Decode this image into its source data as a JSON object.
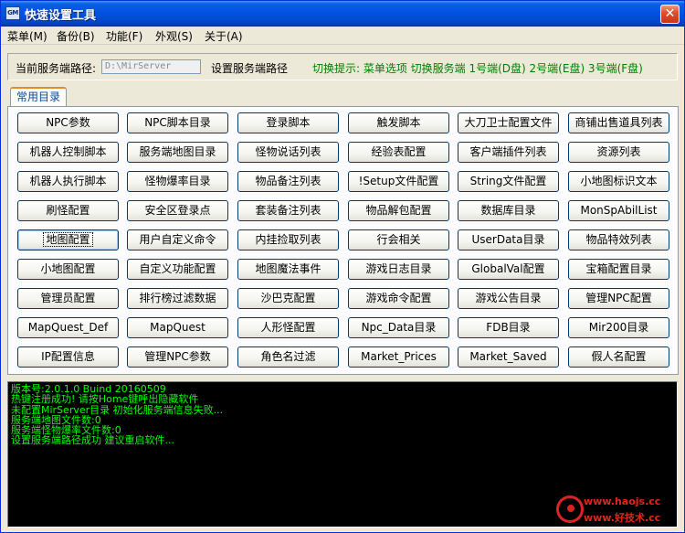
{
  "window": {
    "title": "快速设置工具",
    "icon_text": "GM",
    "close_label": "✕"
  },
  "menu": [
    {
      "label": "菜单(M)"
    },
    {
      "label": "备份(B)"
    },
    {
      "label": "功能(F)"
    },
    {
      "label": "外观(S)"
    },
    {
      "label": "关于(A)"
    }
  ],
  "path_row": {
    "label": "当前服务端路径:",
    "input_value": "D:\\MirServer",
    "set_label": "设置服务端路径",
    "hint": "切换提示: 菜单选项 切换服务端 1号端(D盘) 2号端(E盘) 3号端(F盘)"
  },
  "tabs": [
    {
      "label": "常用目录",
      "active": true
    }
  ],
  "buttons": [
    [
      "NPC参数",
      "NPC脚本目录",
      "登录脚本",
      "触发脚本",
      "大刀卫士配置文件",
      "商铺出售道具列表"
    ],
    [
      "机器人控制脚本",
      "服务端地图目录",
      "怪物说话列表",
      "经验表配置",
      "客户端插件列表",
      "资源列表"
    ],
    [
      "机器人执行脚本",
      "怪物爆率目录",
      "物品备注列表",
      "!Setup文件配置",
      "String文件配置",
      "小地图标识文本"
    ],
    [
      "刷怪配置",
      "安全区登录点",
      "套装备注列表",
      "物品解包配置",
      "数据库目录",
      "MonSpAbilList"
    ],
    [
      "地图配置",
      "用户自定义命令",
      "内挂捡取列表",
      "行会相关",
      "UserData目录",
      "物品特效列表"
    ],
    [
      "小地图配置",
      "自定义功能配置",
      "地图魔法事件",
      "游戏日志目录",
      "GlobalVal配置",
      "宝箱配置目录"
    ],
    [
      "管理员配置",
      "排行榜过滤数据",
      "沙巴克配置",
      "游戏命令配置",
      "游戏公告目录",
      "管理NPC配置"
    ],
    [
      "MapQuest_Def",
      "MapQuest",
      "人形怪配置",
      "Npc_Data目录",
      "FDB目录",
      "Mir200目录"
    ],
    [
      "IP配置信息",
      "管理NPC参数",
      "角色名过滤",
      "Market_Prices",
      "Market_Saved",
      "假人名配置"
    ]
  ],
  "log": [
    "版本号:2.0.1.0 Buind 20160509",
    "热键注册成功! 请按Home键呼出隐藏软件",
    "未配置MirServer目录 初始化服务端信息失败...",
    "服务端地图文件数:0",
    "服务端怪物爆率文件数:0",
    "设置服务端路径成功 建议重启软件..."
  ],
  "watermark": {
    "url": "www.haojs.cc",
    "cn": "www.好技术.cc"
  },
  "colors": {
    "title_bar": "#0054e3",
    "hint_text": "#008000",
    "log_text": "#00ff00",
    "log_bg": "#000000",
    "tab_accent": "#e68b2c"
  }
}
